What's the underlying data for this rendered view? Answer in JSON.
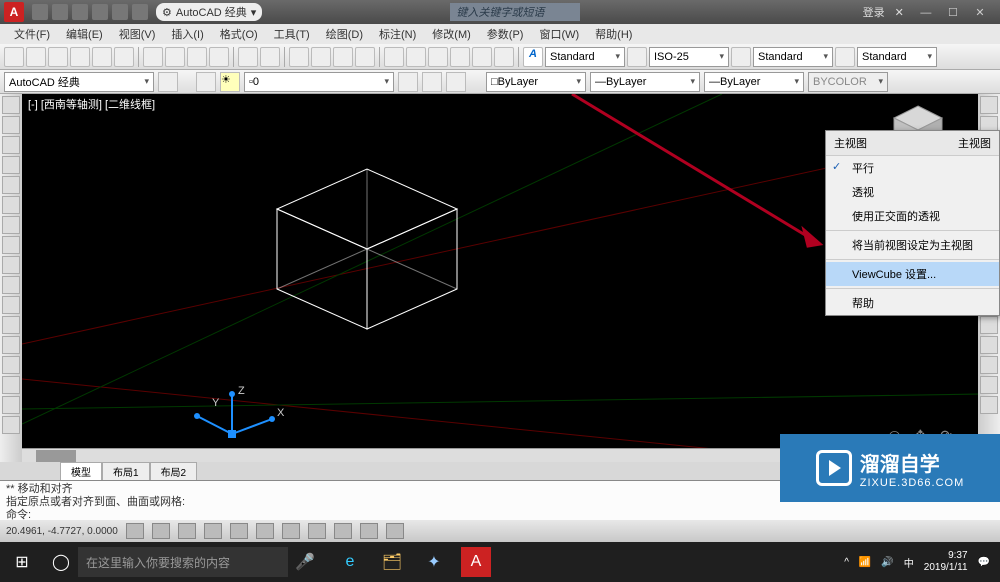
{
  "title": {
    "workspace_name": "AutoCAD 经典",
    "search_placeholder": "键入关键字或短语",
    "login": "登录"
  },
  "menu": [
    "文件(F)",
    "编辑(E)",
    "视图(V)",
    "插入(I)",
    "格式(O)",
    "工具(T)",
    "绘图(D)",
    "标注(N)",
    "修改(M)",
    "参数(P)",
    "窗口(W)",
    "帮助(H)"
  ],
  "styles": {
    "text_style": "Standard",
    "dim_style": "ISO-25",
    "table_style": "Standard",
    "mleader_style": "Standard"
  },
  "row2": {
    "workspace": "AutoCAD 经典",
    "layer_num": "0",
    "layer_combo": "ByLayer",
    "linetype": "ByLayer",
    "lineweight": "ByLayer",
    "color": "BYCOLOR"
  },
  "view_label": "[-] [西南等轴测] [二维线框]",
  "tabs": {
    "model": "模型",
    "layout1": "布局1",
    "layout2": "布局2"
  },
  "cmd": {
    "line1": "** 移动和对齐",
    "line2": "指定原点或者对齐到面、曲面或网格:",
    "prompt": "命令:"
  },
  "status": {
    "coords": "20.4961, -4.7727, 0.0000"
  },
  "context": {
    "hdr1": "主视图",
    "hdr2": "主视图",
    "items": [
      {
        "label": "平行",
        "checked": true
      },
      {
        "label": "透视"
      },
      {
        "label": "使用正交面的透视"
      },
      {
        "sep": true
      },
      {
        "label": "将当前视图设定为主视图"
      },
      {
        "sep": true
      },
      {
        "label": "ViewCube 设置...",
        "selected": true
      },
      {
        "sep": true
      },
      {
        "label": "帮助"
      }
    ]
  },
  "axes": {
    "x": "X",
    "y": "Y",
    "z": "Z"
  },
  "taskbar": {
    "search_placeholder": "在这里输入你要搜索的内容",
    "time": "9:37",
    "date": "2019/1/11"
  },
  "watermark": {
    "cn": "溜溜自学",
    "url": "ZIXUE.3D66.COM"
  }
}
